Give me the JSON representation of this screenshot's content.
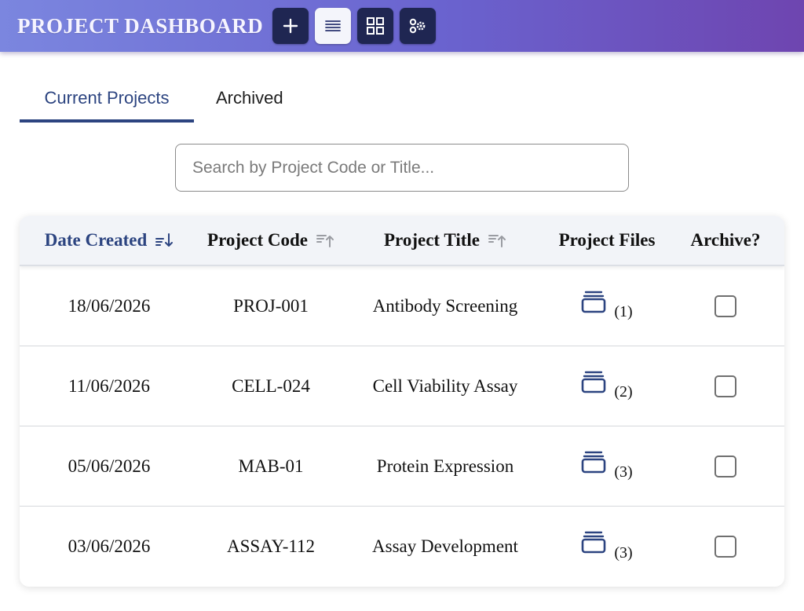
{
  "header": {
    "title": "PROJECT DASHBOARD",
    "buttons": [
      {
        "name": "add-button",
        "icon": "plus-icon"
      },
      {
        "name": "list-view-button",
        "icon": "list-icon",
        "active": true
      },
      {
        "name": "grid-view-button",
        "icon": "grid-icon"
      },
      {
        "name": "settings-button",
        "icon": "gear-icon"
      }
    ],
    "colors": {
      "gradient_start": "#7b86df",
      "gradient_end": "#6e45b0",
      "button_bg": "#1f2652"
    }
  },
  "tabs": [
    {
      "label": "Current Projects",
      "active": true
    },
    {
      "label": "Archived",
      "active": false
    }
  ],
  "search": {
    "placeholder": "Search by Project Code or Title...",
    "value": ""
  },
  "table": {
    "columns": [
      {
        "label": "Date Created",
        "sort": "descending",
        "icon": "sort-descending-icon"
      },
      {
        "label": "Project Code",
        "sort": "ascending",
        "icon": "sort-ascending-icon"
      },
      {
        "label": "Project Title",
        "sort": "ascending",
        "icon": "sort-ascending-icon"
      },
      {
        "label": "Project Files"
      },
      {
        "label": "Archive?"
      }
    ],
    "rows": [
      {
        "date": "18/06/2026",
        "code": "PROJ-001",
        "title": "Antibody Screening",
        "files": "(1)",
        "archived": false
      },
      {
        "date": "11/06/2026",
        "code": "CELL-024",
        "title": "Cell Viability Assay",
        "files": "(2)",
        "archived": false
      },
      {
        "date": "05/06/2026",
        "code": "MAB-01",
        "title": "Protein Expression",
        "files": "(3)",
        "archived": false
      },
      {
        "date": "03/06/2026",
        "code": "ASSAY-112",
        "title": "Assay Development",
        "files": "(3)",
        "archived": false
      }
    ],
    "folder_icon": "folder-icon",
    "accent_color": "#2c4480"
  }
}
